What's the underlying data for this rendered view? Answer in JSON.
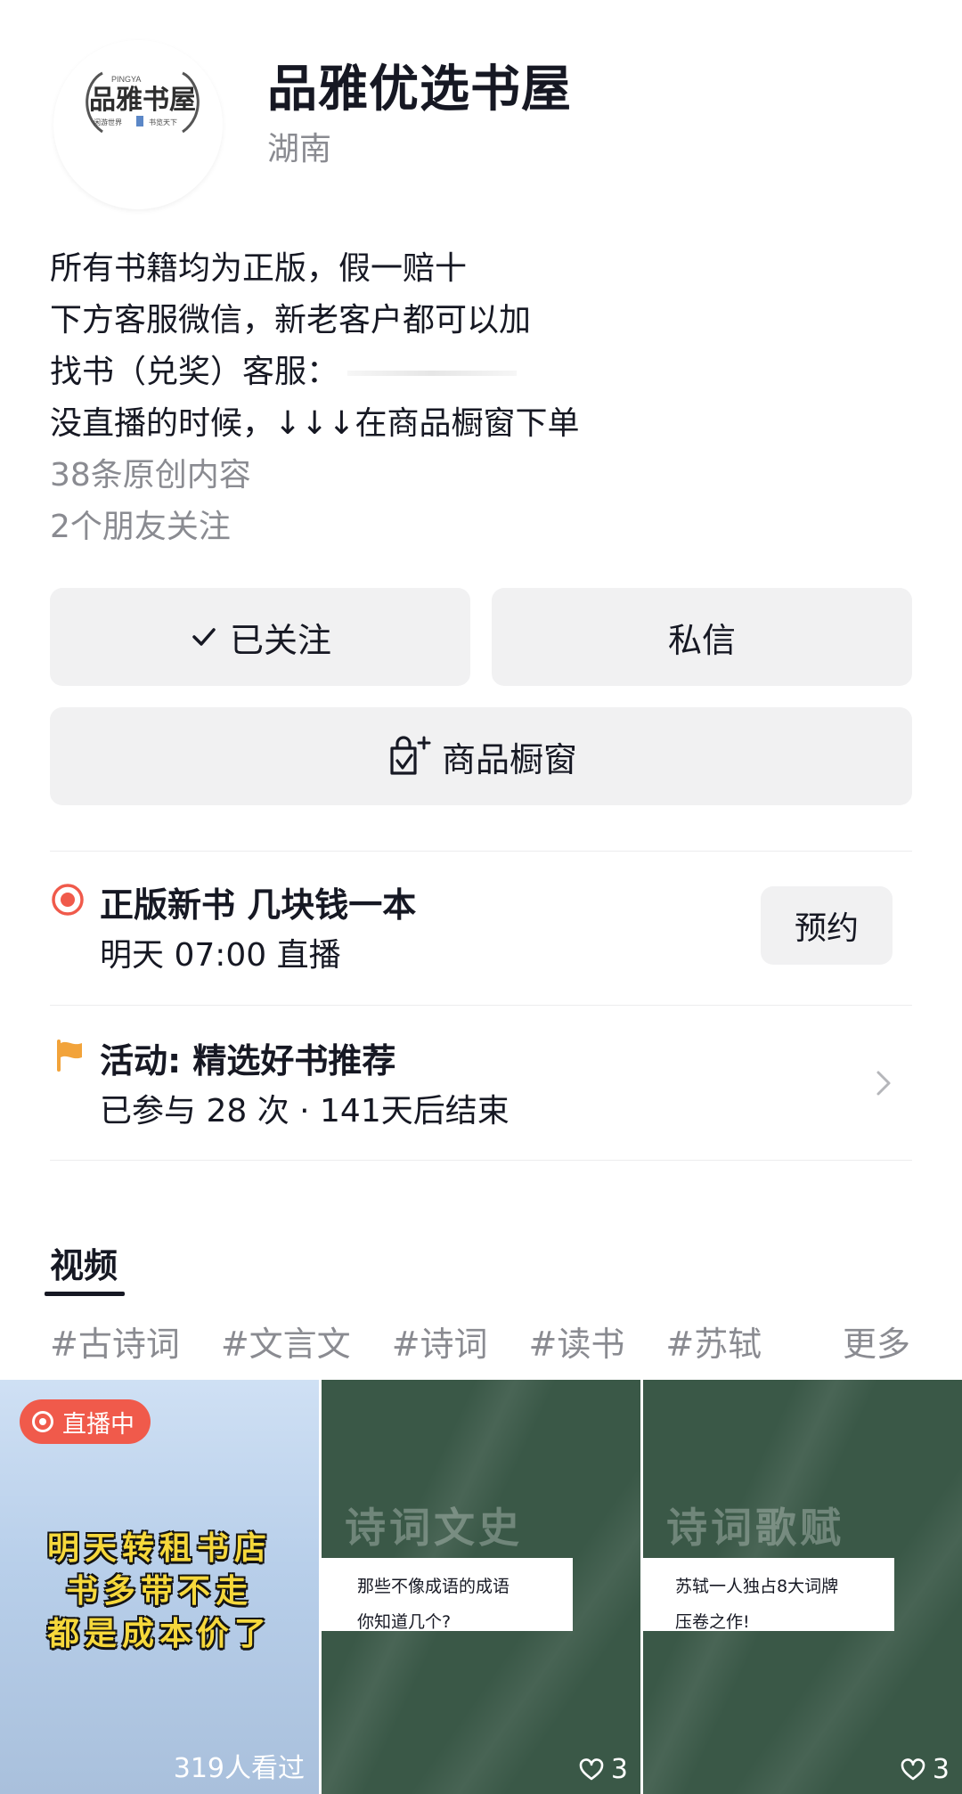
{
  "profile": {
    "logo_text": "品雅书屋",
    "logo_sub": "PINGYA",
    "logo_slogan_left": "闲游世界",
    "logo_slogan_right": "书览天下",
    "name": "品雅优选书屋",
    "region": "湖南"
  },
  "bio": {
    "line1": "所有书籍均为正版，假一赔十",
    "line2": "下方客服微信，新老客户都可以加",
    "line3": "找书（兑奖）客服：",
    "line4": "没直播的时候，↓↓↓在商品橱窗下单",
    "original_count": "38条原创内容",
    "friends_follow": "2个朋友关注"
  },
  "actions": {
    "follow_label": "已关注",
    "message_label": "私信",
    "shop_label": "商品橱窗"
  },
  "live": {
    "title": "正版新书 几块钱一本",
    "time": "明天 07:00 直播",
    "reserve_label": "预约",
    "accent": "#f05a4b"
  },
  "activity": {
    "title": "活动: 精选好书推荐",
    "sub": "已参与 28 次 · 141天后结束",
    "accent": "#f2a33a"
  },
  "tabs": {
    "video": "视频",
    "tags": [
      "#古诗词",
      "#文言文",
      "#诗词",
      "#读书",
      "#苏轼"
    ],
    "more": "更多"
  },
  "videos": [
    {
      "badge": "直播中",
      "lines": [
        "明天转租书店",
        "书多带不走",
        "都是成本价了"
      ],
      "views": "319人看过"
    },
    {
      "board_title": "诗词文史",
      "card_lines": [
        "那些不像成语的成语",
        "你知道几个?"
      ],
      "likes": "3"
    },
    {
      "board_title": "诗词歌赋",
      "card_lines": [
        "苏轼一人独占8大词牌",
        "压卷之作!"
      ],
      "likes": "3"
    }
  ]
}
